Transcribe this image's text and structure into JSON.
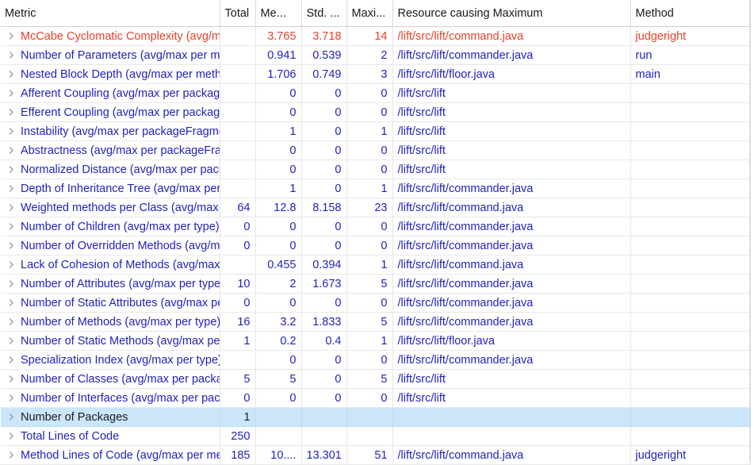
{
  "view": {
    "name": "Metrics",
    "selected_row_index": 20,
    "colors": {
      "normal_text": "#2222bb",
      "warning_text": "#e8402a",
      "header_text": "#1a1a1a",
      "selection_background": "#cbe6fb",
      "grid_line": "#e8e8e8",
      "background": "#ffffff"
    }
  },
  "table": {
    "columns": [
      {
        "key": "metric",
        "label": "Metric",
        "align": "left"
      },
      {
        "key": "total",
        "label": "Total",
        "align": "right"
      },
      {
        "key": "mean",
        "label": "Me...",
        "align": "right"
      },
      {
        "key": "std",
        "label": "Std. ...",
        "align": "right"
      },
      {
        "key": "max",
        "label": "Maxi...",
        "align": "right"
      },
      {
        "key": "resource",
        "label": "Resource causing Maximum",
        "align": "left"
      },
      {
        "key": "method",
        "label": "Method",
        "align": "left"
      }
    ],
    "rows": [
      {
        "metric": "McCabe Cyclomatic Complexity (avg/max per method)",
        "total": "",
        "mean": "3.765",
        "std": "3.718",
        "max": "14",
        "resource": "/lift/src/lift/command.java",
        "method": "judgeright",
        "warn": true,
        "selected": false,
        "expandable": true
      },
      {
        "metric": "Number of Parameters (avg/max per method)",
        "total": "",
        "mean": "0.941",
        "std": "0.539",
        "max": "2",
        "resource": "/lift/src/lift/commander.java",
        "method": "run",
        "warn": false,
        "selected": false,
        "expandable": true
      },
      {
        "metric": "Nested Block Depth (avg/max per method)",
        "total": "",
        "mean": "1.706",
        "std": "0.749",
        "max": "3",
        "resource": "/lift/src/lift/floor.java",
        "method": "main",
        "warn": false,
        "selected": false,
        "expandable": true
      },
      {
        "metric": "Afferent Coupling (avg/max per packageFragment)",
        "total": "",
        "mean": "0",
        "std": "0",
        "max": "0",
        "resource": "/lift/src/lift",
        "method": "",
        "warn": false,
        "selected": false,
        "expandable": true
      },
      {
        "metric": "Efferent Coupling (avg/max per packageFragment)",
        "total": "",
        "mean": "0",
        "std": "0",
        "max": "0",
        "resource": "/lift/src/lift",
        "method": "",
        "warn": false,
        "selected": false,
        "expandable": true
      },
      {
        "metric": "Instability (avg/max per packageFragment)",
        "total": "",
        "mean": "1",
        "std": "0",
        "max": "1",
        "resource": "/lift/src/lift",
        "method": "",
        "warn": false,
        "selected": false,
        "expandable": true
      },
      {
        "metric": "Abstractness (avg/max per packageFragment)",
        "total": "",
        "mean": "0",
        "std": "0",
        "max": "0",
        "resource": "/lift/src/lift",
        "method": "",
        "warn": false,
        "selected": false,
        "expandable": true
      },
      {
        "metric": "Normalized Distance (avg/max per packageFragment)",
        "total": "",
        "mean": "0",
        "std": "0",
        "max": "0",
        "resource": "/lift/src/lift",
        "method": "",
        "warn": false,
        "selected": false,
        "expandable": true
      },
      {
        "metric": "Depth of Inheritance Tree (avg/max per type)",
        "total": "",
        "mean": "1",
        "std": "0",
        "max": "1",
        "resource": "/lift/src/lift/commander.java",
        "method": "",
        "warn": false,
        "selected": false,
        "expandable": true
      },
      {
        "metric": "Weighted methods per Class (avg/max per type)",
        "total": "64",
        "mean": "12.8",
        "std": "8.158",
        "max": "23",
        "resource": "/lift/src/lift/command.java",
        "method": "",
        "warn": false,
        "selected": false,
        "expandable": true
      },
      {
        "metric": "Number of Children (avg/max per type)",
        "total": "0",
        "mean": "0",
        "std": "0",
        "max": "0",
        "resource": "/lift/src/lift/commander.java",
        "method": "",
        "warn": false,
        "selected": false,
        "expandable": true
      },
      {
        "metric": "Number of Overridden Methods (avg/max per type)",
        "total": "0",
        "mean": "0",
        "std": "0",
        "max": "0",
        "resource": "/lift/src/lift/commander.java",
        "method": "",
        "warn": false,
        "selected": false,
        "expandable": true
      },
      {
        "metric": "Lack of Cohesion of Methods (avg/max per type)",
        "total": "",
        "mean": "0.455",
        "std": "0.394",
        "max": "1",
        "resource": "/lift/src/lift/command.java",
        "method": "",
        "warn": false,
        "selected": false,
        "expandable": true
      },
      {
        "metric": "Number of Attributes (avg/max per type)",
        "total": "10",
        "mean": "2",
        "std": "1.673",
        "max": "5",
        "resource": "/lift/src/lift/commander.java",
        "method": "",
        "warn": false,
        "selected": false,
        "expandable": true
      },
      {
        "metric": "Number of Static Attributes (avg/max per type)",
        "total": "0",
        "mean": "0",
        "std": "0",
        "max": "0",
        "resource": "/lift/src/lift/commander.java",
        "method": "",
        "warn": false,
        "selected": false,
        "expandable": true
      },
      {
        "metric": "Number of Methods (avg/max per type)",
        "total": "16",
        "mean": "3.2",
        "std": "1.833",
        "max": "5",
        "resource": "/lift/src/lift/commander.java",
        "method": "",
        "warn": false,
        "selected": false,
        "expandable": true
      },
      {
        "metric": "Number of Static Methods (avg/max per type)",
        "total": "1",
        "mean": "0.2",
        "std": "0.4",
        "max": "1",
        "resource": "/lift/src/lift/floor.java",
        "method": "",
        "warn": false,
        "selected": false,
        "expandable": true
      },
      {
        "metric": "Specialization Index (avg/max per type)",
        "total": "",
        "mean": "0",
        "std": "0",
        "max": "0",
        "resource": "/lift/src/lift/commander.java",
        "method": "",
        "warn": false,
        "selected": false,
        "expandable": true
      },
      {
        "metric": "Number of Classes (avg/max per packageFragment)",
        "total": "5",
        "mean": "5",
        "std": "0",
        "max": "5",
        "resource": "/lift/src/lift",
        "method": "",
        "warn": false,
        "selected": false,
        "expandable": true
      },
      {
        "metric": "Number of Interfaces (avg/max per packageFragment)",
        "total": "0",
        "mean": "0",
        "std": "0",
        "max": "0",
        "resource": "/lift/src/lift",
        "method": "",
        "warn": false,
        "selected": false,
        "expandable": true
      },
      {
        "metric": "Number of Packages",
        "total": "1",
        "mean": "",
        "std": "",
        "max": "",
        "resource": "",
        "method": "",
        "warn": false,
        "selected": true,
        "expandable": true
      },
      {
        "metric": "Total Lines of Code",
        "total": "250",
        "mean": "",
        "std": "",
        "max": "",
        "resource": "",
        "method": "",
        "warn": false,
        "selected": false,
        "expandable": true
      },
      {
        "metric": "Method Lines of Code (avg/max per method)",
        "total": "185",
        "mean": "10....",
        "std": "13.301",
        "max": "51",
        "resource": "/lift/src/lift/command.java",
        "method": "judgeright",
        "warn": false,
        "selected": false,
        "expandable": true
      }
    ]
  },
  "icons": {
    "expand_twisty": "chevron-right-icon"
  }
}
